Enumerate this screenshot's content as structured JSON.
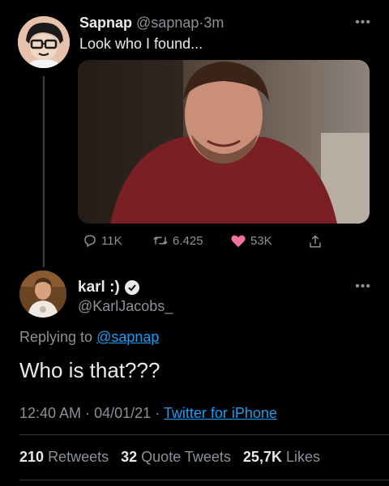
{
  "tweet": {
    "author_name": "Sapnap",
    "author_handle": "@sapnap",
    "time_ago": "3m",
    "separator": "·",
    "text": "Look who I found...",
    "replies": "11K",
    "retweets": "6.425",
    "likes": "53K",
    "like_color": "#f91880"
  },
  "reply": {
    "author_name": "karl :)",
    "author_handle": "@KarlJacobs_",
    "replying_prefix": "Replying to",
    "replying_to": "@sapnap",
    "text": "Who is that???",
    "time": "12:40 AM",
    "date": "04/01/21",
    "source": "Twitter for iPhone"
  },
  "stats": {
    "retweets_count": "210",
    "retweets_label": "Retweets",
    "quotes_count": "32",
    "quotes_label": "Quote Tweets",
    "likes_count": "25,7K",
    "likes_label": "Likes"
  },
  "icons": [
    "more-icon",
    "reply-icon",
    "retweet-icon",
    "heart-icon",
    "share-icon",
    "verified-icon"
  ],
  "colors": {
    "background": "#000000",
    "link": "#1d9bf0",
    "muted": "#8b9196"
  }
}
